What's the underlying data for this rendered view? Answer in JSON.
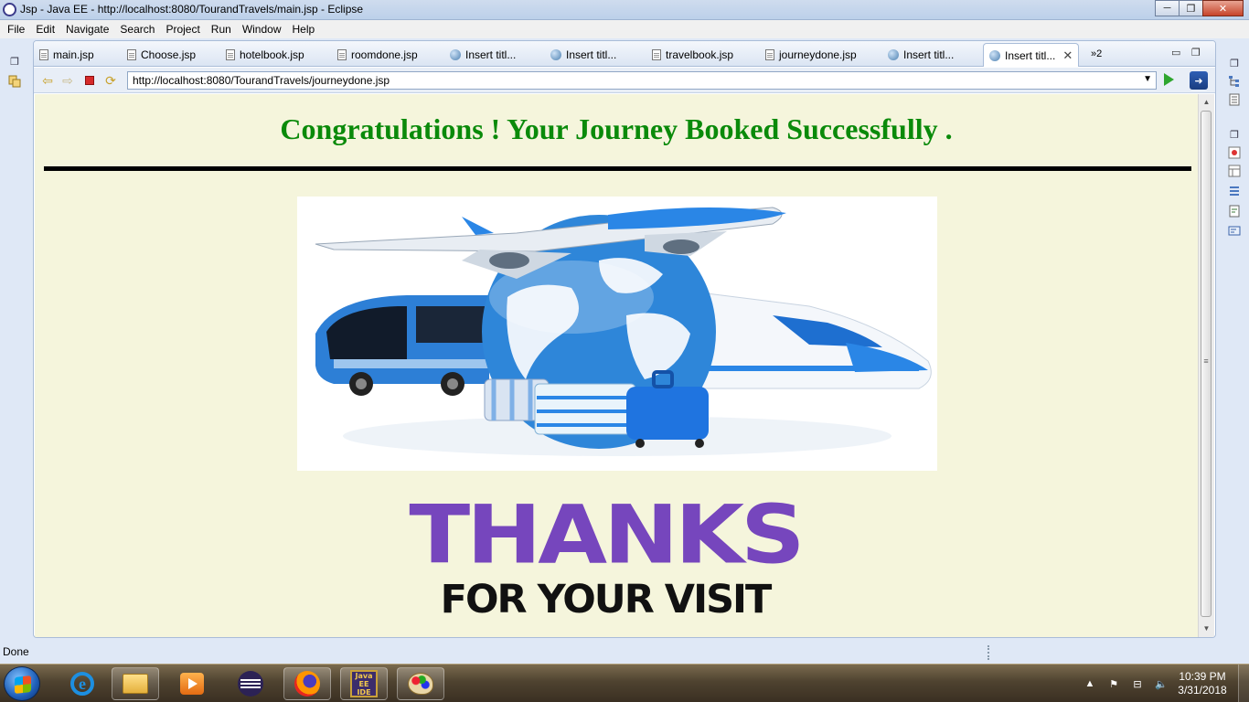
{
  "window": {
    "title": "Jsp - Java EE - http://localhost:8080/TourandTravels/main.jsp - Eclipse",
    "minimize_glyph": "─",
    "maximize_glyph": "❐",
    "close_glyph": "✕"
  },
  "menubar": {
    "items": [
      "File",
      "Edit",
      "Navigate",
      "Search",
      "Project",
      "Run",
      "Window",
      "Help"
    ]
  },
  "editor": {
    "tabs": [
      {
        "label": "main.jsp",
        "icon": "jsp-file-icon"
      },
      {
        "label": "Choose.jsp",
        "icon": "jsp-file-icon"
      },
      {
        "label": "hotelbook.jsp",
        "icon": "jsp-file-icon"
      },
      {
        "label": "roomdone.jsp",
        "icon": "jsp-file-icon"
      },
      {
        "label": "Insert titl...",
        "icon": "globe-icon"
      },
      {
        "label": "Insert titl...",
        "icon": "globe-icon"
      },
      {
        "label": "travelbook.jsp",
        "icon": "jsp-file-icon"
      },
      {
        "label": "journeydone.jsp",
        "icon": "jsp-file-icon"
      },
      {
        "label": "Insert titl...",
        "icon": "globe-icon"
      },
      {
        "label": "Insert titl...",
        "icon": "globe-icon",
        "active": true
      }
    ],
    "overflow_count": "»2",
    "close_glyph": "✕",
    "minimize_glyph": "▭",
    "maximize_glyph": "❐"
  },
  "browser": {
    "url": "http://localhost:8080/TourandTravels/journeydone.jsp",
    "dropdown_glyph": "▼",
    "back_glyph": "⇦",
    "forward_glyph": "⇨",
    "refresh_glyph": "⟳"
  },
  "page": {
    "heading": "Congratulations ! Your Journey Booked Successfully .",
    "image_alt": "travel-image",
    "thanks_line1": "THANKS",
    "thanks_line2": "FOR YOUR VISIT",
    "colors": {
      "background": "#f5f5dc",
      "heading": "#0a8a0a",
      "thanks_purple": "#7646bd",
      "thanks_dark": "#111111"
    }
  },
  "scrollbar": {
    "up_glyph": "▲",
    "down_glyph": "▼",
    "grip_glyph": "≡"
  },
  "status": {
    "text": "Done"
  },
  "taskbar": {
    "apps": [
      {
        "name": "internet-explorer-icon",
        "active": false
      },
      {
        "name": "file-explorer-icon",
        "active": true
      },
      {
        "name": "media-player-icon",
        "active": false
      },
      {
        "name": "eclipse-icon",
        "active": false
      },
      {
        "name": "firefox-icon",
        "active": true
      },
      {
        "name": "java-ee-ide-icon",
        "active": true,
        "label_top": "Java EE",
        "label_bottom": "IDE"
      },
      {
        "name": "paint-icon",
        "active": true
      }
    ],
    "tray_arrow": "▲",
    "tray_flag": "⚑",
    "tray_network": "⊟",
    "tray_volume": "🔈",
    "time": "10:39 PM",
    "date": "3/31/2018"
  }
}
